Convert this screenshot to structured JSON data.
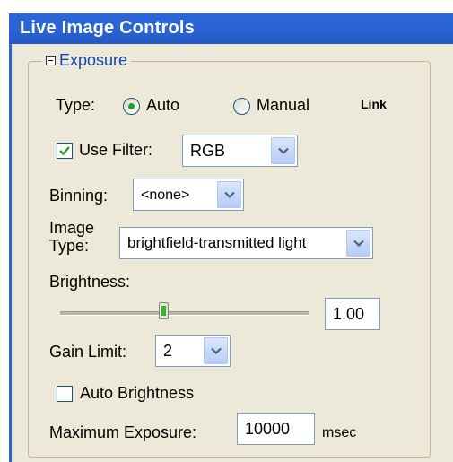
{
  "window": {
    "title": "Live Image Controls"
  },
  "exposure": {
    "group_label": "Exposure",
    "type_label": "Type:",
    "type_options": [
      "Auto",
      "Manual"
    ],
    "type_selected": "Auto",
    "link_label": "Link",
    "use_filter": {
      "label": "Use Filter:",
      "checked": true,
      "value": "RGB"
    },
    "binning": {
      "label": "Binning:",
      "value": "<none>"
    },
    "image_type": {
      "label_line1": "Image",
      "label_line2": "Type:",
      "value": "brightfield-transmitted light"
    },
    "brightness": {
      "label": "Brightness:",
      "value": "1.00",
      "slider_level": 0.4
    },
    "gain_limit": {
      "label": "Gain Limit:",
      "value": "2"
    },
    "auto_brightness": {
      "label": "Auto Brightness",
      "checked": false
    },
    "max_exposure": {
      "label": "Maximum Exposure:",
      "value": "10000",
      "unit": "msec"
    }
  },
  "colors": {
    "title_bar": "#2a63d2",
    "panel_bg": "#ece9d8",
    "radio_selected": "#21a121",
    "legend_text": "#1546b0"
  },
  "icons": {
    "collapse": "collapse-minus-icon",
    "dropdown": "chevron-down-icon",
    "checkmark": "checkmark-icon"
  }
}
